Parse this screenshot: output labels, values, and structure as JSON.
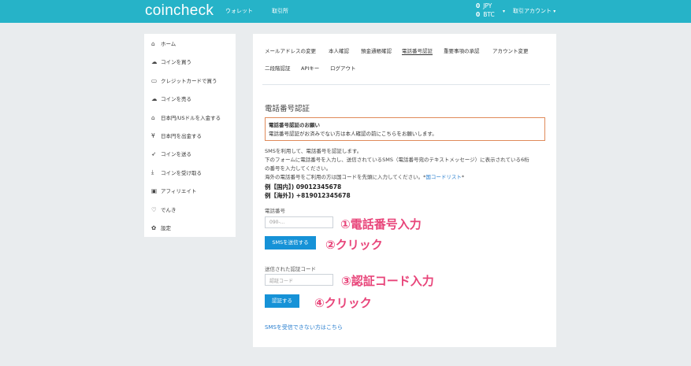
{
  "header": {
    "logo": "coincheck",
    "nav": [
      "ウォレット",
      "取引所"
    ],
    "balances": [
      {
        "amount": "0",
        "currency": "JPY"
      },
      {
        "amount": "0",
        "currency": "BTC"
      }
    ],
    "account_menu": "取引アカウント"
  },
  "sidebar": {
    "items": [
      {
        "icon": "home-icon",
        "glyph": "⌂",
        "label": "ホーム"
      },
      {
        "icon": "cloud-download-icon",
        "glyph": "☁",
        "label": "コインを買う"
      },
      {
        "icon": "credit-card-icon",
        "glyph": "▭",
        "label": "クレジットカードで買う"
      },
      {
        "icon": "cloud-upload-icon",
        "glyph": "☁",
        "label": "コインを売る"
      },
      {
        "icon": "bank-icon",
        "glyph": "⌂",
        "label": "日本円/USドルを入金する"
      },
      {
        "icon": "yen-icon",
        "glyph": "¥",
        "label": "日本円を出金する"
      },
      {
        "icon": "send-icon",
        "glyph": "➶",
        "label": "コインを送る"
      },
      {
        "icon": "receive-icon",
        "glyph": "⤓",
        "label": "コインを受け取る"
      },
      {
        "icon": "gift-icon",
        "glyph": "▣",
        "label": "アフィリエイト"
      },
      {
        "icon": "bulb-icon",
        "glyph": "♡",
        "label": "でんき"
      },
      {
        "icon": "gear-icon",
        "glyph": "✿",
        "label": "設定"
      }
    ]
  },
  "tabs": {
    "row1": [
      "メールアドレスの変更",
      "本人確認",
      "預金通帳確認",
      "電話番号認証",
      "重要事項の承認",
      "アカウント変更"
    ],
    "row2": [
      "二段階認証",
      "APIキー",
      "ログアウト"
    ]
  },
  "main": {
    "title": "電話番号認証",
    "notice_heading": "電話番号認証のお願い",
    "notice_body": "電話番号認証がお済みでない方は本人確認の前にこちらをお願いします。",
    "desc_lines": [
      "SMSを利用して、電話番号を認証します。",
      "下のフォームに電話番号を入力し、送信されているSMS（電話番号宛のテキストメッセージ）に表示されている6桁",
      "の番号を入力してください。"
    ],
    "desc_line4_prefix": "海外の電話番号をご利用の方は国コードを先頭に入力してください。*",
    "desc_line4_link": "国コードリスト",
    "desc_line4_suffix": "*",
    "example_domestic": "例【国内】) 09012345678",
    "example_overseas": "例【海外】) +819012345678",
    "phone_label": "電話番号",
    "phone_placeholder": "090-...",
    "send_sms_button": "SMSを送信する",
    "code_label": "送信された認証コード",
    "code_placeholder": "認証コード",
    "verify_button": "認証する",
    "no_sms_link": "SMSを受信できない方はこちら"
  },
  "annotations": {
    "step1": "①電話番号入力",
    "step2": "②クリック",
    "step3": "③認証コード入力",
    "step4": "④クリック"
  },
  "colors": {
    "topbar": "#26b3c8",
    "button": "#1692d7",
    "notice_border": "#e08a5a",
    "annotation": "#e8457a",
    "link": "#2a7fcf"
  }
}
